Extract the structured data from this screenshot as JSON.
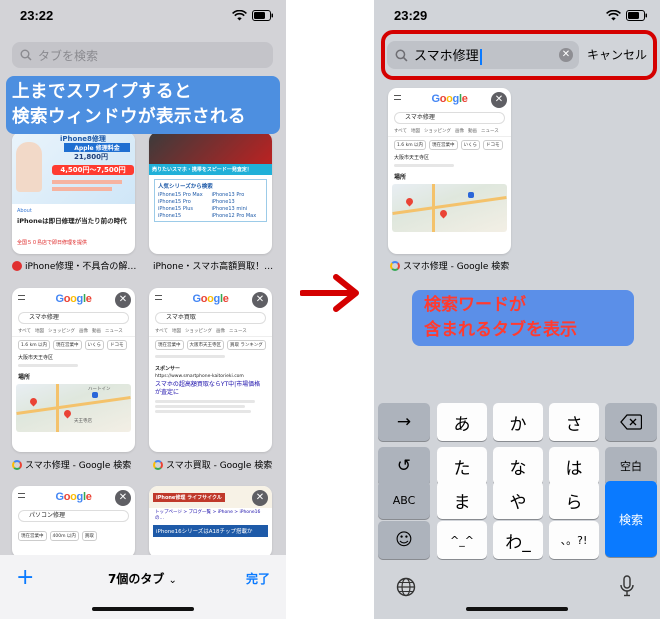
{
  "left_screen": {
    "status_time": "23:22",
    "search_placeholder": "タブを検索",
    "callout_line1": "上までスワイプすると",
    "callout_line2": "検索ウィンドウが表示される",
    "cards": [
      {
        "top_lines": [
          "iPhone8修理",
          "Apple 修理料金",
          "21,800円",
          "4,500円〜7,500円"
        ],
        "about_label": "About",
        "heading": "iPhoneは即日修理が当たり前の時代",
        "footer": "全国５０島店で即日修理を提供",
        "caption": "iPhone修理・不具合の解…"
      },
      {
        "banner": "売りたいスマホ・携帯をスピード一発査定！",
        "series_title": "人気シリーズから検索",
        "series_list": [
          "iPhone15 Pro Max",
          "iPhone15 Pro",
          "iPhone15 Plus",
          "iPhone15",
          "iPhone13 Pro",
          "iPhone13",
          "iPhone13 mini",
          "iPhone12 Pro Max"
        ],
        "caption": "iPhone・スマホ高額買取！…"
      },
      {
        "google_logo": [
          "G",
          "o",
          "o",
          "g",
          "l",
          "e"
        ],
        "query": "スマホ修理",
        "tabs": [
          "すべて",
          "地図",
          "ショッピング",
          "画像",
          "動画",
          "ニュース"
        ],
        "chips": [
          "1.6 km 以内",
          "現在営業中",
          "いくら",
          "ドコモ"
        ],
        "area": "大阪市天王寺区",
        "map_label": "場所",
        "map_places": [
          "ハートイン",
          "天王寺店"
        ],
        "caption": "スマホ修理 - Google 検索"
      },
      {
        "query": "スマホ買取",
        "tabs": [
          "すべて",
          "地図",
          "ショッピング",
          "画像",
          "ニュース"
        ],
        "chips": [
          "現在営業中",
          "大阪市天王寺区",
          "買取 ランキング"
        ],
        "sponsor": "スポンサー",
        "ad_url": "https://www.smartphone-kaitorieki.com",
        "ad_title": "スマホの超高額買取ならYT中|市場価格が査定に",
        "caption": "スマホ買取 - Google 検索"
      },
      {
        "query": "パソコン修理",
        "chips": [
          "現在営業中",
          "400m 以内",
          "買取"
        ],
        "caption": ""
      },
      {
        "banner": "iPhone修理 ライフサイクル",
        "breadcrumb": "トップページ > ブログ一覧 > iPhone > iPhone16の…",
        "heading": "iPhone16シリーズはA18チップ搭載か",
        "caption": ""
      }
    ],
    "bottom_bar": {
      "plus": "+",
      "tabs_count": "7個のタブ",
      "done": "完了"
    }
  },
  "right_screen": {
    "status_time": "23:29",
    "search_value": "スマホ修理",
    "cancel": "キャンセル",
    "result_card": {
      "query": "スマホ修理",
      "tabs": [
        "すべて",
        "地図",
        "ショッピング",
        "画像",
        "動画",
        "ニュース"
      ],
      "chips": [
        "1.6 km 以内",
        "現在営業中",
        "いくら",
        "ドコモ"
      ],
      "area": "大阪市天王寺区",
      "map_label": "場所",
      "caption": "スマホ修理 - Google 検索"
    },
    "callout_line1": "検索ワードが",
    "callout_line2": "含まれるタブを表示",
    "keyboard": {
      "row1": [
        "→",
        "あ",
        "か",
        "さ",
        "⌫"
      ],
      "row2": [
        "↺",
        "た",
        "な",
        "は",
        "空白"
      ],
      "row3": [
        "ABC",
        "ま",
        "や",
        "ら",
        "検索"
      ],
      "row4": [
        "☺",
        "^_^",
        "わ_",
        "、。?!"
      ],
      "globe": "globe-icon",
      "mic": "mic-icon"
    }
  },
  "colors": {
    "accent_blue": "#0a7aff",
    "callout_blue": "#4d8fe0",
    "highlight_red": "#d40000",
    "arrow_red": "#d40000"
  }
}
